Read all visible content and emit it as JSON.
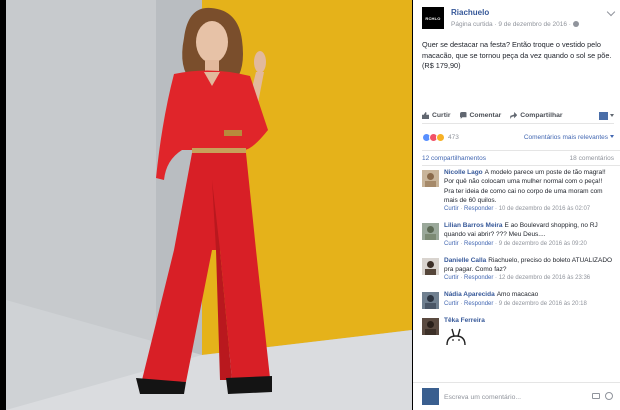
{
  "post": {
    "page_name": "Riachuelo",
    "avatar_text": "RCHLO",
    "meta": "Página curtida · 9 de dezembro de 2016 ·",
    "text": "Quer se destacar na festa? Então troque o vestido pelo macacão, que se tornou peça da vez quando o sol se põe. (R$ 179,90)"
  },
  "actions": {
    "like": "Curtir",
    "comment": "Comentar",
    "share": "Compartilhar"
  },
  "reactions": {
    "count": "473",
    "sort_label": "Comentários mais relevantes",
    "colors": {
      "like": "#5890ff",
      "love": "#f25268",
      "wow": "#f7b125"
    }
  },
  "counts": {
    "shares": "12 compartilhamentos",
    "comments": "18 comentários"
  },
  "comments": [
    {
      "name": "Nicolle Lago",
      "text": "A modelo parece um poste de tão magra!! Por quê não colocam uma mulher normal com o peça!! Pra ter ideia de como cai no corpo de uma moram com mais de 60 quilos.",
      "like": "Curtir",
      "reply": "Responder",
      "time": "10 de dezembro de 2016 às 02:07"
    },
    {
      "name": "Lilian Barros Meira",
      "text": "E ao Boulevard shopping, no RJ quando vai abrir? ??? Meu Deus....",
      "like": "Curtir",
      "reply": "Responder",
      "time": "9 de dezembro de 2016 às 09:20"
    },
    {
      "name": "Danielle Calla",
      "text": "Riachuelo, preciso do boleto ATUALIZADO pra pagar. Como faz?",
      "like": "Curtir",
      "reply": "Responder",
      "time": "12 de dezembro de 2016 às 23:36"
    },
    {
      "name": "Nádia Aparecida",
      "text": "Amo macacao",
      "like": "Curtir",
      "reply": "Responder",
      "time": "9 de dezembro de 2016 às 20:18"
    },
    {
      "name": "Têka Ferreira",
      "text": ""
    }
  ],
  "composer": {
    "placeholder": "Escreva um comentário..."
  },
  "colors": {
    "brand_link": "#365899",
    "accent": "#4267b2",
    "jumpsuit_red": "#e0252a",
    "wall_yellow": "#e5b21a"
  }
}
